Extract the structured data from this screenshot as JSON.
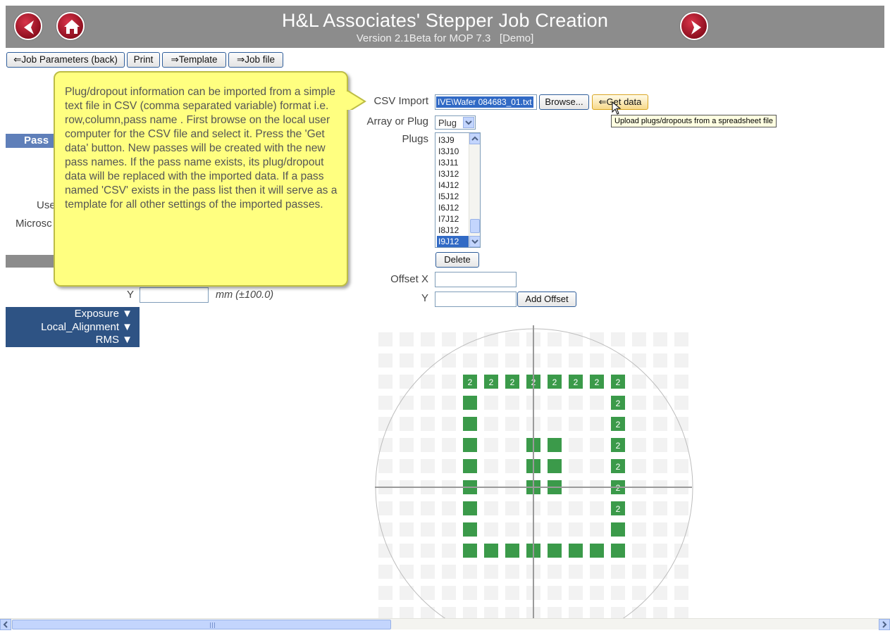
{
  "header": {
    "title": "H&L Associates' Stepper Job Creation",
    "subtitle": "Version 2.1Beta for MOP 7.3   [Demo]",
    "back_icon": "back-arrow-icon",
    "home_icon": "home-icon",
    "forward_icon": "forward-arrow-icon",
    "accent": "#8c8c8c"
  },
  "toolbar": {
    "job_parameters": "⇐Job Parameters (back)",
    "print": "Print",
    "template": "⇒Template",
    "job_file": "⇒Job file"
  },
  "callout": {
    "text": "Plug/dropout information can be imported from a simple text file in CSV (comma separated variable) format i.e. row,column,pass name . First browse on the local user computer for the CSV file and select it. Press the 'Get data' button. New passes will be created with the new pass names. If the pass name exists, its plug/dropout data will be replaced with the imported data. If a pass named 'CSV' exists in the pass list then it will serve as a template for all other settings of the imported passes."
  },
  "left": {
    "pass_header": "Pass",
    "use_label": "Use",
    "micro_label": "Microsc",
    "y_label": "Y",
    "y_unit": "mm (±100.0)",
    "menu": [
      "Exposure ▼",
      "Local_Alignment ▼",
      "RMS ▼"
    ]
  },
  "form": {
    "csv_label": "CSV Import",
    "csv_value": "IVE\\Wafer 084683_01.txt",
    "browse": "Browse...",
    "get_data": "⇐Get data",
    "tooltip": "Upload plugs/dropouts from a spreadsheet file",
    "array_plug_label": "Array or Plug",
    "array_plug_value": "Plug",
    "plugs_label": "Plugs",
    "plugs": [
      "I3J9",
      "I3J10",
      "I3J11",
      "I3J12",
      "I4J12",
      "I5J12",
      "I6J12",
      "I7J12",
      "I8J12",
      "I9J12"
    ],
    "selected_plug": "I9J12",
    "delete": "Delete",
    "offset_x_label": "Offset X",
    "offset_y_label": "Y",
    "add_offset": "Add Offset"
  },
  "wafer": {
    "cols": 15,
    "rows": 14,
    "cell_color": "#f2f2f2",
    "plug_color": "#3b9a4a",
    "badge_text": "2",
    "active_cells": [
      [
        2,
        4,
        "2"
      ],
      [
        2,
        5,
        "2"
      ],
      [
        2,
        6,
        "2"
      ],
      [
        2,
        7,
        "2"
      ],
      [
        2,
        8,
        "2"
      ],
      [
        2,
        9,
        "2"
      ],
      [
        2,
        10,
        "2"
      ],
      [
        2,
        11,
        "2"
      ],
      [
        3,
        4,
        ""
      ],
      [
        3,
        11,
        "2"
      ],
      [
        4,
        4,
        ""
      ],
      [
        4,
        11,
        "2"
      ],
      [
        5,
        4,
        ""
      ],
      [
        5,
        7,
        ""
      ],
      [
        5,
        8,
        ""
      ],
      [
        5,
        11,
        "2"
      ],
      [
        6,
        4,
        ""
      ],
      [
        6,
        7,
        ""
      ],
      [
        6,
        8,
        ""
      ],
      [
        6,
        11,
        "2"
      ],
      [
        7,
        4,
        ""
      ],
      [
        7,
        7,
        ""
      ],
      [
        7,
        8,
        ""
      ],
      [
        7,
        11,
        "2"
      ],
      [
        8,
        4,
        ""
      ],
      [
        8,
        11,
        "2"
      ],
      [
        9,
        4,
        ""
      ],
      [
        9,
        11,
        ""
      ],
      [
        10,
        4,
        ""
      ],
      [
        10,
        5,
        ""
      ],
      [
        10,
        6,
        ""
      ],
      [
        10,
        7,
        ""
      ],
      [
        10,
        8,
        ""
      ],
      [
        10,
        9,
        ""
      ],
      [
        10,
        10,
        ""
      ],
      [
        10,
        11,
        ""
      ]
    ]
  }
}
